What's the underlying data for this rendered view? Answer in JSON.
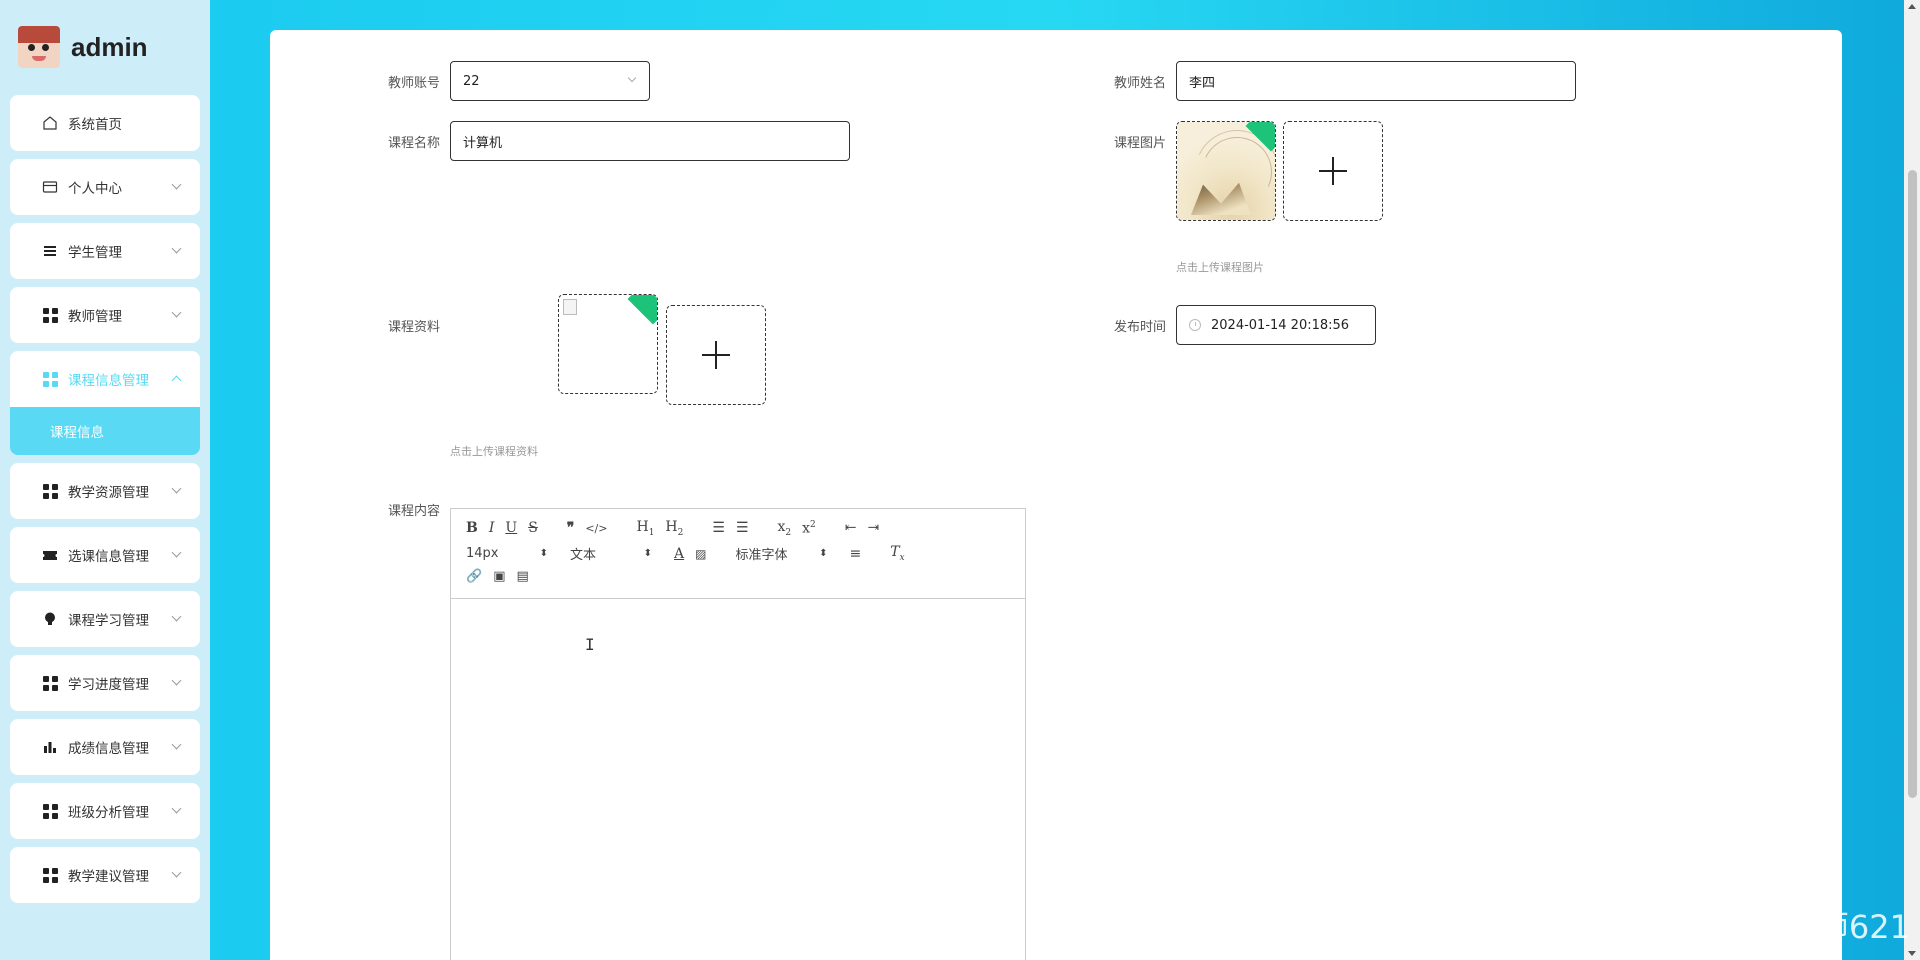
{
  "brand": {
    "name": "admin"
  },
  "sidebar": {
    "items": [
      {
        "label": "系统首页",
        "icon": "home-icon"
      },
      {
        "label": "个人中心",
        "icon": "card-icon"
      },
      {
        "label": "学生管理",
        "icon": "list-icon"
      },
      {
        "label": "教师管理",
        "icon": "grid-icon"
      },
      {
        "label": "课程信息管理",
        "icon": "grid-icon",
        "expanded": true
      },
      {
        "label": "教学资源管理",
        "icon": "grid-icon"
      },
      {
        "label": "选课信息管理",
        "icon": "ticket-icon"
      },
      {
        "label": "课程学习管理",
        "icon": "bulb-icon"
      },
      {
        "label": "学习进度管理",
        "icon": "grid-icon"
      },
      {
        "label": "成绩信息管理",
        "icon": "bar-chart-icon"
      },
      {
        "label": "班级分析管理",
        "icon": "grid-icon"
      },
      {
        "label": "教学建议管理",
        "icon": "grid-icon"
      }
    ],
    "subitem": {
      "label": "课程信息"
    }
  },
  "form": {
    "teacher_account": {
      "label": "教师账号",
      "value": "22"
    },
    "teacher_name": {
      "label": "教师姓名",
      "value": "李四"
    },
    "course_name": {
      "label": "课程名称",
      "value": "计算机"
    },
    "course_image": {
      "label": "课程图片",
      "hint": "点击上传课程图片"
    },
    "course_material": {
      "label": "课程资料",
      "hint": "点击上传课程资料"
    },
    "publish_time": {
      "label": "发布时间",
      "value": "2024-01-14 20:18:56"
    },
    "course_content": {
      "label": "课程内容"
    }
  },
  "editor": {
    "font_size": "14px",
    "block_type": "文本",
    "font_family": "标准字体"
  },
  "watermark": "CSDN @王老师621",
  "colors": {
    "accent": "#5ad9f2",
    "background": "#19c8ef"
  }
}
